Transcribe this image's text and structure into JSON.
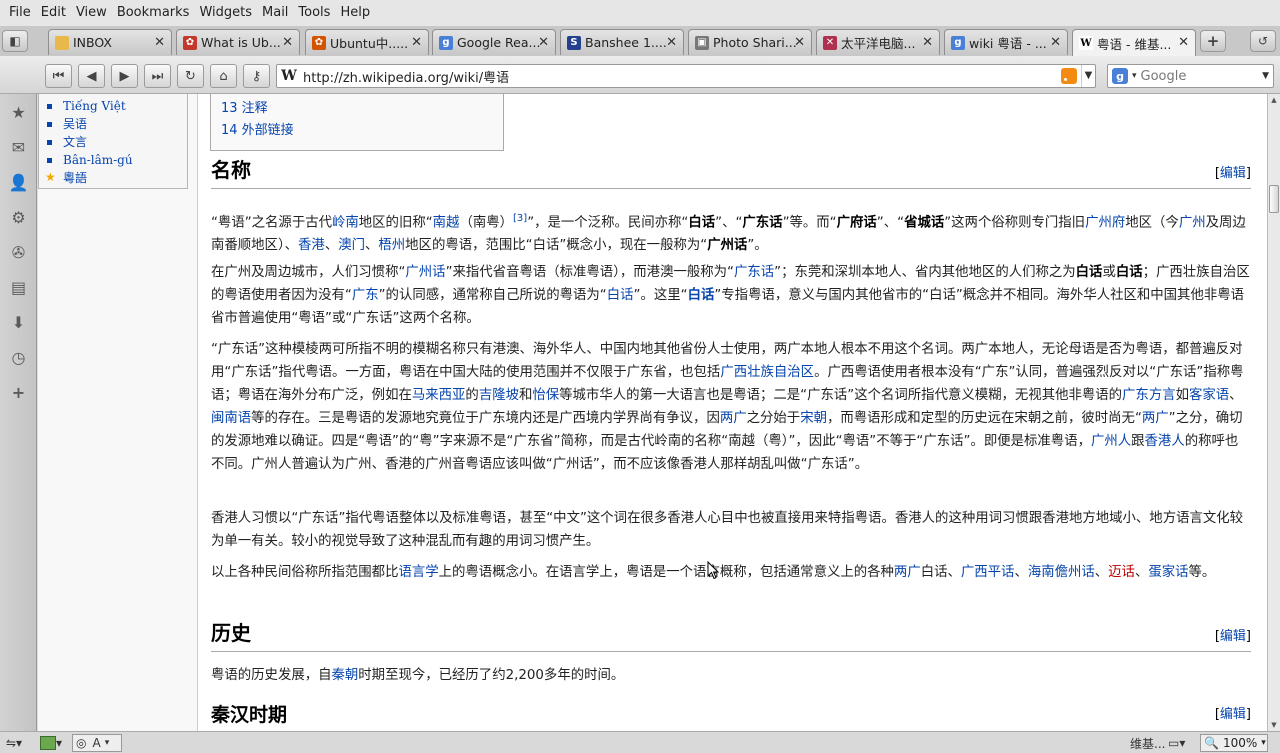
{
  "menu": [
    "File",
    "Edit",
    "View",
    "Bookmarks",
    "Widgets",
    "Mail",
    "Tools",
    "Help"
  ],
  "tabs": [
    {
      "title": "INBOX",
      "fav_color": "#e8b84a",
      "fav_char": ""
    },
    {
      "title": "What is Ub...",
      "fav_color": "#c0392b",
      "fav_char": "✿"
    },
    {
      "title": "Ubuntu中.....",
      "fav_color": "#d35400",
      "fav_char": "✿"
    },
    {
      "title": "Google Rea...",
      "fav_color": "#4a7fd8",
      "fav_char": "g"
    },
    {
      "title": "Banshee 1....",
      "fav_color": "#25408f",
      "fav_char": "S"
    },
    {
      "title": "Photo Shari...",
      "fav_color": "#777777",
      "fav_char": "▣"
    },
    {
      "title": "太平洋电脑...",
      "fav_color": "#b03050",
      "fav_char": "✕"
    },
    {
      "title": "wiki 粤语 - ...",
      "fav_color": "#4a7fd8",
      "fav_char": "g"
    },
    {
      "title": "粤语 - 维基...",
      "fav_color": "#ffffff",
      "fav_char": "W",
      "active": true
    }
  ],
  "url": "http://zh.wikipedia.org/wiki/粤语",
  "search_placeholder": "Google",
  "languages": [
    "Tiếng Việt",
    "吴语",
    "文言",
    "Bân-lâm-gú",
    "粵語"
  ],
  "toc": [
    "13 注释",
    "14 外部链接"
  ],
  "edit_open": "[",
  "edit_label": "编辑",
  "edit_close": "]",
  "sections": {
    "naming_title": "名称",
    "history_title": "历史",
    "qinhan_title": "秦汉时期"
  },
  "paragraphs": {
    "p1": [
      {
        "t": "“粤语”之名源于古代"
      },
      {
        "t": "岭南",
        "l": 1
      },
      {
        "t": "地区的旧称“"
      },
      {
        "t": "南越",
        "l": 1
      },
      {
        "t": "（南粤）"
      },
      {
        "t": "[3]",
        "s": 1
      },
      {
        "t": "”，是一个泛称。民间亦称“"
      },
      {
        "t": "白话",
        "b": 1
      },
      {
        "t": "”、“"
      },
      {
        "t": "广东话",
        "b": 1
      },
      {
        "t": "”等。而“"
      },
      {
        "t": "广府话",
        "b": 1
      },
      {
        "t": "”、“"
      },
      {
        "t": "省城话",
        "b": 1
      },
      {
        "t": "”这两个俗称则专门指旧"
      },
      {
        "t": "广州府",
        "l": 1
      },
      {
        "t": "地区（今"
      },
      {
        "t": "广州",
        "l": 1
      },
      {
        "t": "及周边南番顺地区）、"
      },
      {
        "t": "香港",
        "l": 1
      },
      {
        "t": "、"
      },
      {
        "t": "澳门",
        "l": 1
      },
      {
        "t": "、"
      },
      {
        "t": "梧州",
        "l": 1
      },
      {
        "t": "地区的粤语，范围比“白话”概念小，现在一般称为“"
      },
      {
        "t": "广州话",
        "b": 1
      },
      {
        "t": "”。"
      }
    ],
    "p2": [
      {
        "t": "在广州及周边城市，人们习惯称“"
      },
      {
        "t": "广州话",
        "l": 1
      },
      {
        "t": "”来指代省音粤语（标准粤语），而港澳一般称为“"
      },
      {
        "t": "广东话",
        "l": 1
      },
      {
        "t": "”；东莞和深圳本地人、省内其他地区的人们称之为"
      },
      {
        "t": "白话",
        "b": 1
      },
      {
        "t": "或"
      },
      {
        "t": "白话",
        "b": 1
      },
      {
        "t": "；广西壮族自治区的粤语使用者因为没有“"
      },
      {
        "t": "广东",
        "l": 1
      },
      {
        "t": "”的认同感，通常称自己所说的粤语为“"
      },
      {
        "t": "白话",
        "l": 1
      },
      {
        "t": "”。这里“"
      },
      {
        "t": "白话",
        "l": 1,
        "b": 1
      },
      {
        "t": "”专指粤语，意义与国内其他省市的“白话”概念并不相同。海外华人社区和中国其他非粤语省市普遍使用“粤语”或“广东话”这两个名称。"
      }
    ],
    "p3": [
      {
        "t": "“广东话”这种模棱两可所指不明的模糊名称只有港澳、海外华人、中国内地其他省份人士使用，两广本地人根本不用这个名词。两广本地人，无论母语是否为粤语，都普遍反对用“广东话”指代粤语。一方面，粤语在中国大陆的使用范围并不仅限于广东省，也包括"
      },
      {
        "t": "广西壮族自治区",
        "l": 1
      },
      {
        "t": "。广西粤语使用者根本没有“广东”认同，普遍强烈反对以“广东话”指称粤语；粤语在海外分布广泛，例如在"
      },
      {
        "t": "马来西亚",
        "l": 1
      },
      {
        "t": "的"
      },
      {
        "t": "吉隆坡",
        "l": 1
      },
      {
        "t": "和"
      },
      {
        "t": "怡保",
        "l": 1
      },
      {
        "t": "等城市华人的第一大语言也是粤语；二是“广东话”这个名词所指代意义模糊，无视其他非粤语的"
      },
      {
        "t": "广东方言",
        "l": 1
      },
      {
        "t": "如"
      },
      {
        "t": "客家语",
        "l": 1
      },
      {
        "t": "、"
      },
      {
        "t": "闽南语",
        "l": 1
      },
      {
        "t": "等的存在。三是粤语的发源地究竟位于广东境内还是广西境内学界尚有争议，因"
      },
      {
        "t": "两广",
        "l": 1
      },
      {
        "t": "之分始于"
      },
      {
        "t": "宋朝",
        "l": 1
      },
      {
        "t": "，而粤语形成和定型的历史远在宋朝之前，彼时尚无“"
      },
      {
        "t": "两广",
        "l": 1
      },
      {
        "t": "”之分，确切的发源地难以确证。四是“粤语”的“粤”字来源不是“广东省”简称，而是古代岭南的名称“南越（粤）”，因此“粤语”不等于“广东话”。即便是标准粤语，"
      },
      {
        "t": "广州人",
        "l": 1
      },
      {
        "t": "跟"
      },
      {
        "t": "香港人",
        "l": 1
      },
      {
        "t": "的称呼也不同。广州人普遍认为广州、香港的广州音粤语应该叫做“广州话”，而不应该像香港人那样胡乱叫做“广东话”。"
      }
    ],
    "p4": [
      {
        "t": "香港人习惯以“广东话”指代粤语整体以及标准粤语，甚至“中文”这个词在很多香港人心目中也被直接用来特指粤语。香港人的这种用词习惯跟香港地方地域小、地方语言文化较为单一有关。较小的视觉导致了这种混乱而有趣的用词习惯产生。"
      }
    ],
    "p5": [
      {
        "t": "以上各种民间俗称所指范围都比"
      },
      {
        "t": "语言学",
        "l": 1
      },
      {
        "t": "上的粤语概念小。在语言学上，粤语是一个语言概称，包括通常意义上的各种"
      },
      {
        "t": "两广",
        "l": 1
      },
      {
        "t": "白话、"
      },
      {
        "t": "广西平话",
        "l": 1
      },
      {
        "t": "、"
      },
      {
        "t": "海南儋州话",
        "l": 1
      },
      {
        "t": "、"
      },
      {
        "t": "迈话",
        "r": 1
      },
      {
        "t": "、"
      },
      {
        "t": "蛋家话",
        "l": 1
      },
      {
        "t": "等。"
      }
    ],
    "p6": [
      {
        "t": "粤语的历史发展，自"
      },
      {
        "t": "秦朝",
        "l": 1
      },
      {
        "t": "时期至现今，已经历了约2,200多年的时间。"
      }
    ]
  },
  "status": {
    "zoom": "100%",
    "ime": "A",
    "page_label": "维基..."
  }
}
